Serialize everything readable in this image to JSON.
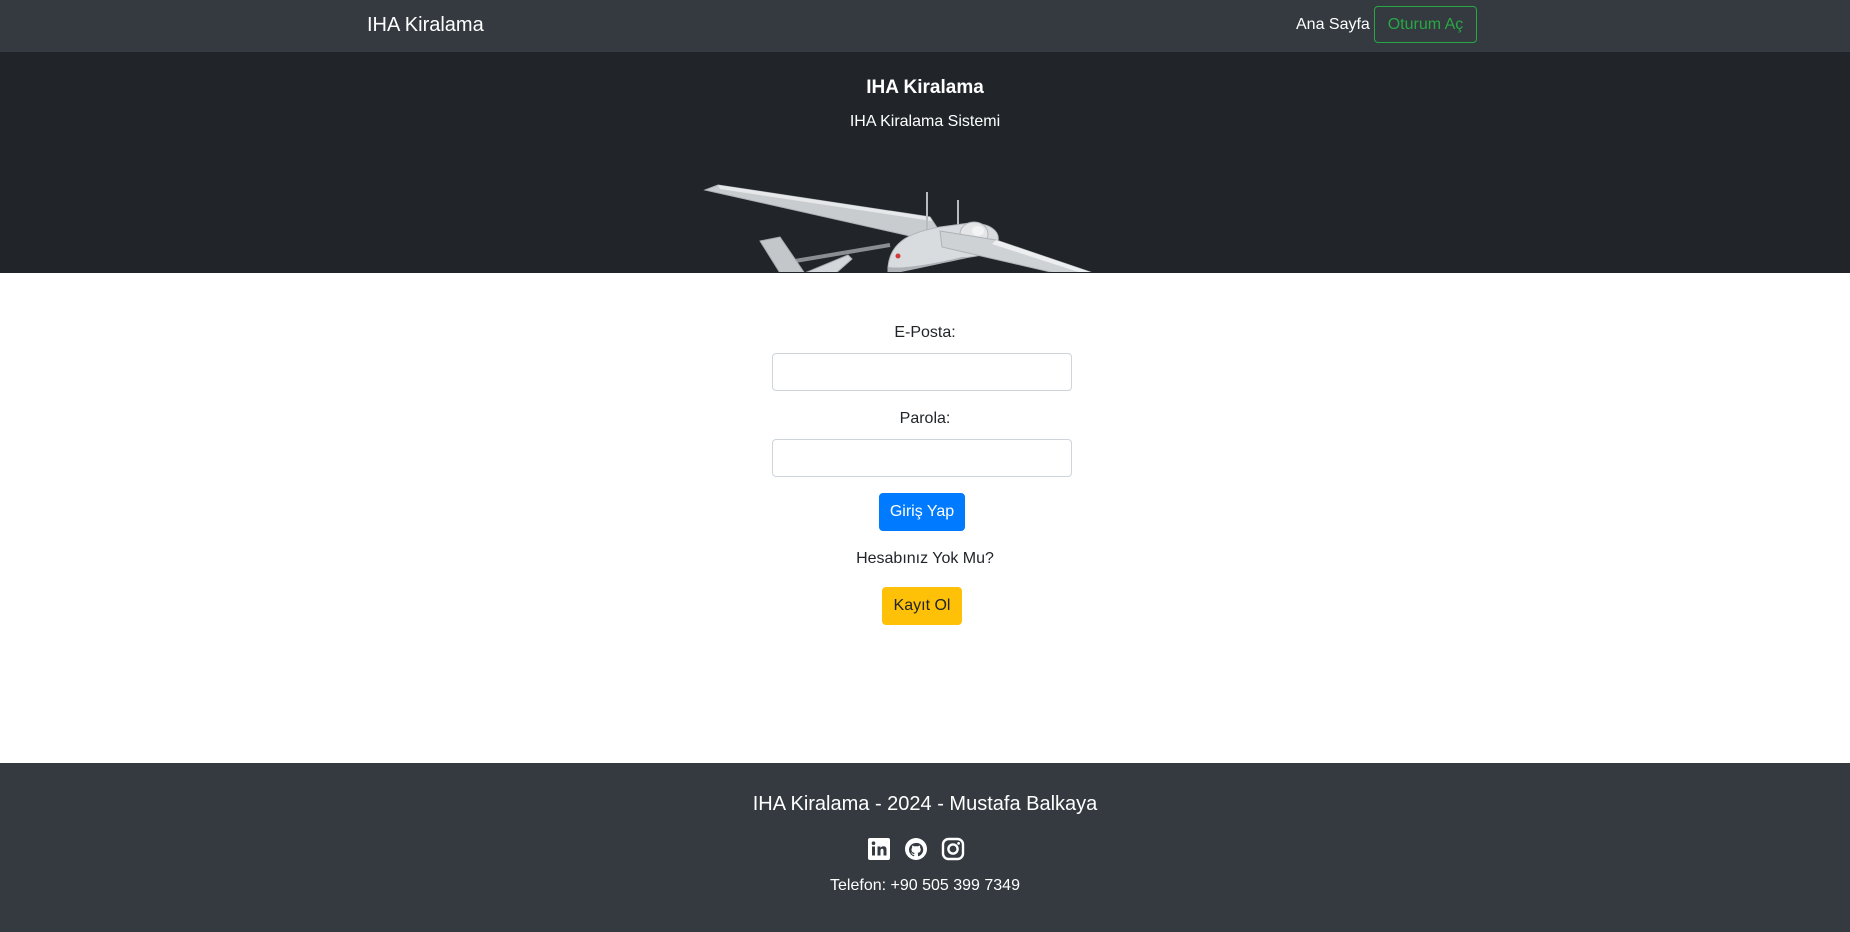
{
  "navbar": {
    "brand": "IHA Kiralama",
    "home_label": "Ana Sayfa",
    "login_label": "Oturum Aç"
  },
  "hero": {
    "title": "IHA Kiralama",
    "subtitle": "IHA Kiralama Sistemi",
    "image": "fixed-wing-drone-image"
  },
  "login_form": {
    "email_label": "E-Posta:",
    "email_value": "",
    "password_label": "Parola:",
    "password_value": "",
    "submit_label": "Giriş Yap",
    "no_account_text": "Hesabınız Yok Mu?",
    "register_label": "Kayıt Ol"
  },
  "footer": {
    "title": "IHA Kiralama - 2024 - Mustafa Balkaya",
    "social_icons": [
      "linkedin-icon",
      "github-icon",
      "instagram-icon"
    ],
    "phone_label": "Telefon:",
    "phone_number": "+90 505 399 7349"
  },
  "colors": {
    "navbar_bg": "#343a40",
    "hero_bg": "#212529",
    "primary": "#007bff",
    "success": "#28a745",
    "warning": "#ffc107"
  }
}
